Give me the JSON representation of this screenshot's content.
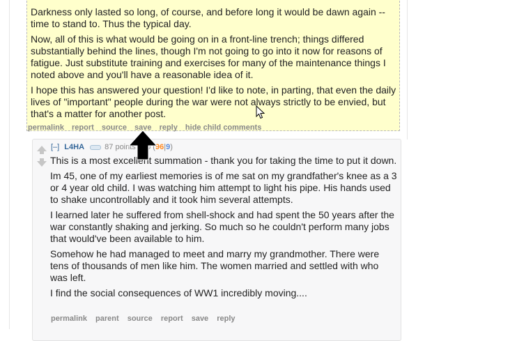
{
  "outer_comment": {
    "paragraphs": [
      "Darkness only lasted so long, of course, and before long it would be dawn again -- time to stand to. Thus the typical day.",
      "Now, all of this is what would be going on in a front-line trench; things differed substantially behind the lines, though I'm not going to go into it now for reasons of fatigue. Just substitute training and exercises for many of the maintenance things I noted above and you'll have a reasonable idea of it.",
      "I hope this has answered your question! I'd like to note, in parting, that even the daily lives of \"important\" people during the war were not always strictly to be envied, but that's a matter for another post."
    ],
    "buttons": [
      "permalink",
      "report",
      "source",
      "save",
      "reply",
      "hide child comments"
    ]
  },
  "child_comment": {
    "collapse": "[–]",
    "author": "L4HA",
    "points": "87 points",
    "age": "ago",
    "vote_open": "(",
    "ups": "96",
    "sep": "|",
    "downs": "9",
    "vote_close": ")",
    "paragraphs": [
      "This is a most excellent summation - thank you for taking the time to put it down.",
      "Im 45, one of my earliest memories is of me sat on my grandfather's knee as a 3 or 4 year old child. I was watching him attempt to light his pipe. His hands used to shake uncontrollably and it took him several attempts.",
      "I learned later he suffered from shell-shock and had spent the 50 years after the war constantly shaking and jerking. So much so he couldn't perform many jobs that would've been available to him.",
      "Somehow he had managed to meet and marry my grandmother. There were tens of thousands of men like him. The women married and settled with who was left.",
      "I find the social consequences of WW1 incredibly moving...."
    ],
    "buttons": [
      "permalink",
      "parent",
      "source",
      "report",
      "save",
      "reply"
    ]
  },
  "colors": {
    "highlight_bg": "#ffffcc",
    "child_bg": "#f7f7f8",
    "link_blue": "#336699",
    "upvote_count": "#ff8b24",
    "downvote_count": "#5c8cdb"
  },
  "icons": {
    "upvote": "upvote-arrow-icon",
    "downvote": "downvote-arrow-icon",
    "flair": "flair-icon",
    "cursor_large": "arrow-up-cursor-icon",
    "cursor_pointer": "mouse-pointer-icon"
  }
}
